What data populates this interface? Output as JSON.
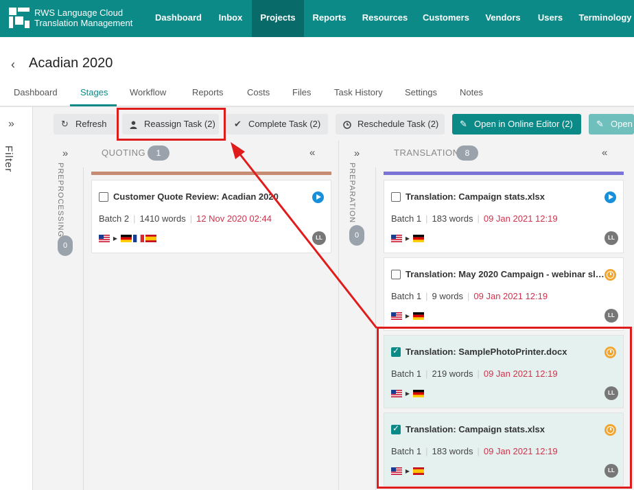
{
  "header": {
    "brand_line1": "RWS Language Cloud",
    "brand_line2": "Translation Management",
    "nav": [
      "Dashboard",
      "Inbox",
      "Projects",
      "Reports",
      "Resources",
      "Customers",
      "Vendors",
      "Users",
      "Terminology"
    ],
    "active_nav": "Projects",
    "accent_color": "#0b8a87"
  },
  "project": {
    "back_icon": "chevron-left-icon",
    "title": "Acadian 2020"
  },
  "tabs": [
    "Dashboard",
    "Stages",
    "Workflow",
    "Reports",
    "Costs",
    "Files",
    "Task History",
    "Settings",
    "Notes"
  ],
  "active_tab": "Stages",
  "filter": {
    "label": "Filter",
    "icon": "double-chevron-right-icon"
  },
  "toolbar": {
    "refresh": "Refresh",
    "reassign": "Reassign Task (2)",
    "complete": "Complete Task (2)",
    "reschedule": "Reschedule Task (2)",
    "open_editor": "Open in Online Editor (2)",
    "open_second": "Open"
  },
  "columns": {
    "preprocessing": {
      "label": "PREPROCESSING",
      "count": "0"
    },
    "quoting": {
      "label": "QUOTING",
      "count": "1",
      "bar_color": "#c68b72"
    },
    "preparation": {
      "label": "PREPARATION",
      "count": "0"
    },
    "translation": {
      "label": "TRANSLATION",
      "count": "8",
      "bar_color": "#7b74d6"
    }
  },
  "quoting_cards": [
    {
      "title": "Customer Quote Review: Acadian 2020",
      "batch": "Batch 2",
      "words": "1410 words",
      "due": "12 Nov 2020 02:44",
      "checked": false,
      "status": "play",
      "avatar": "LL"
    }
  ],
  "translation_cards": [
    {
      "title": "Translation: Campaign stats.xlsx",
      "batch": "Batch 1",
      "words": "183 words",
      "due": "09 Jan 2021 12:19",
      "checked": false,
      "status": "play",
      "avatar": "LL"
    },
    {
      "title": "Translation: May 2020 Campaign - webinar slid...",
      "batch": "Batch 1",
      "words": "9 words",
      "due": "09 Jan 2021 12:19",
      "checked": false,
      "status": "clock",
      "avatar": "LL"
    },
    {
      "title": "Translation: SamplePhotoPrinter.docx",
      "batch": "Batch 1",
      "words": "219 words",
      "due": "09 Jan 2021 12:19",
      "checked": true,
      "status": "clock",
      "avatar": "LL"
    },
    {
      "title": "Translation: Campaign stats.xlsx",
      "batch": "Batch 1",
      "words": "183 words",
      "due": "09 Jan 2021 12:19",
      "checked": true,
      "status": "clock",
      "avatar": "LL"
    }
  ],
  "annotation_color": "#e01b1b"
}
